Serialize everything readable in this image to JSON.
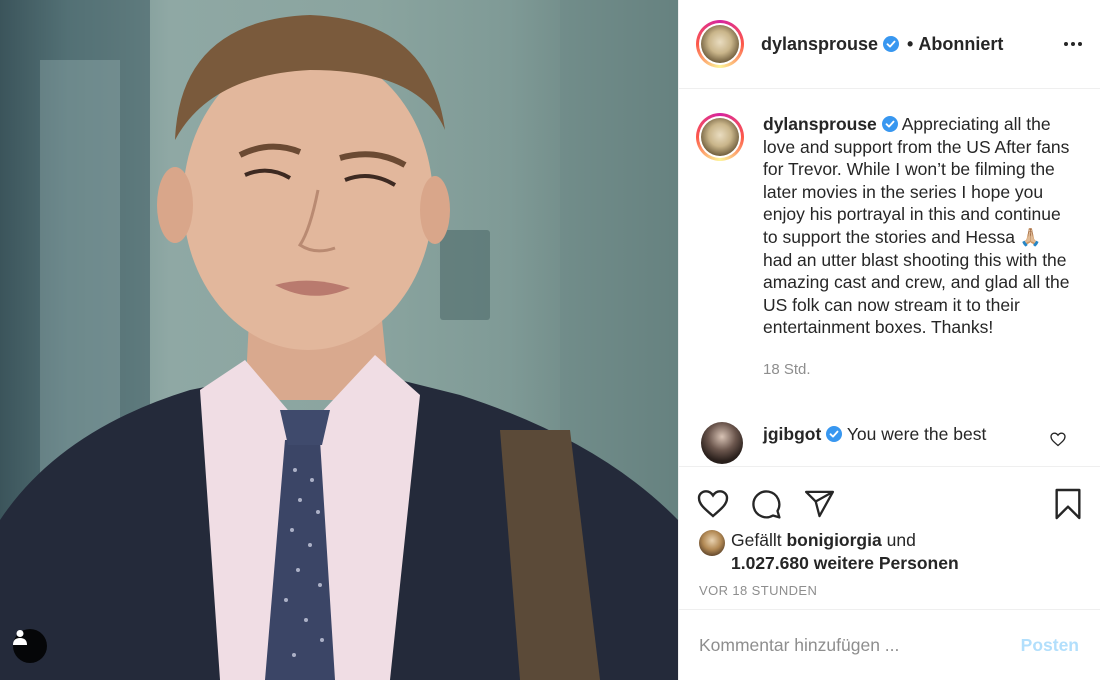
{
  "post": {
    "username": "dylansprouse",
    "separator": "•",
    "follow_status": "Abonniert",
    "caption": "Appreciating all the love and support from the US After fans for Trevor. While I won’t be filming the later movies in the series I hope you enjoy his portrayal in this and continue to support the stories and Hessa 🙏🏼 had an utter blast shooting this with the amazing cast and crew, and glad all the US folk can now stream it to their entertainment boxes. Thanks!",
    "caption_time": "18 Std.",
    "photo_subject": "man in dark suit, pink shirt and dotted tie"
  },
  "comments": [
    {
      "username": "jgibgot",
      "text": "You were the best",
      "verified": true
    }
  ],
  "likes": {
    "prefix": "Gefällt",
    "first_user": "bonigiorgia",
    "connector": "und",
    "count_text": "1.027.680 weitere Personen"
  },
  "timestamp": "VOR 18 STUNDEN",
  "add_comment": {
    "placeholder": "Kommentar hinzufügen ...",
    "post_label": "Posten"
  },
  "colors": {
    "verified_blue": "#3897f0",
    "post_button_disabled": "#b2dffc",
    "muted_text": "#8e8e8e"
  },
  "icons": [
    "user-tag-icon",
    "verified-icon",
    "more-options-icon",
    "heart-icon",
    "comment-icon",
    "share-icon",
    "bookmark-icon"
  ]
}
